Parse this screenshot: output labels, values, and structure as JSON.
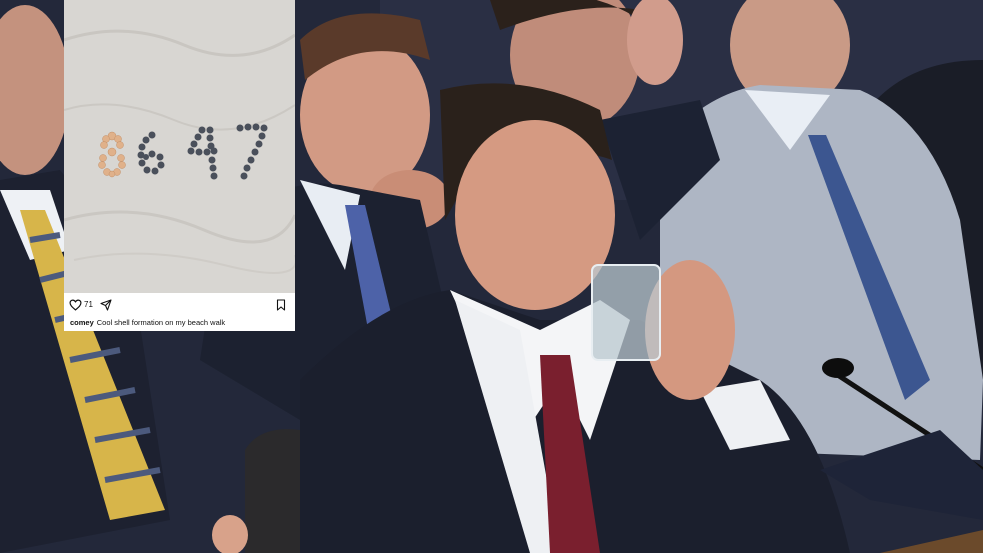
{
  "post": {
    "username": "comey",
    "caption": "Cool shell formation on my beach walk",
    "likes": "71",
    "shell_numbers": "8647"
  },
  "icons": {
    "like": "heart-icon",
    "share": "paper-plane-icon",
    "save": "bookmark-icon"
  },
  "colors": {
    "sand": "#d8d6d2",
    "suit_navy": "#1f2433",
    "tie_red": "#7a1f2e",
    "tie_gold": "#d7b54a",
    "card_bg": "#ffffff"
  }
}
